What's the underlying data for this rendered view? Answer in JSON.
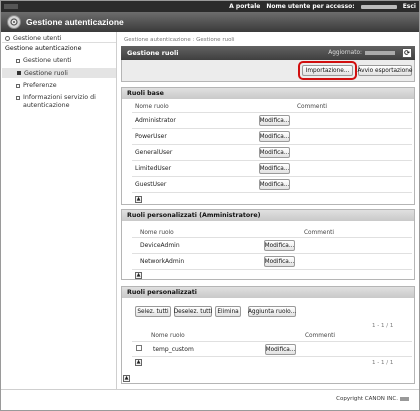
{
  "topbar": {
    "portal_link": "A portale",
    "user_label": "Nome utente per accesso:",
    "logout": "Esci"
  },
  "app": {
    "title": "Gestione autenticazione"
  },
  "sidebar": {
    "top": "Gestione utenti",
    "section": "Gestione autenticazione",
    "items": [
      {
        "label": "Gestione utenti"
      },
      {
        "label": "Gestione ruoli"
      },
      {
        "label": "Preferenze"
      },
      {
        "label": "Informazioni servizio di"
      },
      {
        "label": "autenticazione"
      }
    ]
  },
  "main": {
    "breadcrumb": "Gestione autenticazione : Gestione ruoli",
    "header_title": "Gestione ruoli",
    "updated_label": "Aggiornato:",
    "import_button": "Importazione...",
    "export_button": "Avvio esportazione"
  },
  "basic_roles": {
    "title": "Ruoli base",
    "col_name": "Nome ruolo",
    "col_comments": "Commenti",
    "edit_label": "Modifica...",
    "rows": [
      "Administrator",
      "PowerUser",
      "GeneralUser",
      "LimitedUser",
      "GuestUser"
    ]
  },
  "custom_admin_roles": {
    "title": "Ruoli personalizzati (Amministratore)",
    "col_name": "Nome ruolo",
    "col_comments": "Commenti",
    "edit_label": "Modifica...",
    "rows": [
      "DeviceAdmin",
      "NetworkAdmin"
    ]
  },
  "custom_roles": {
    "title": "Ruoli personalizzati",
    "select_all": "Selez. tutti",
    "deselect_all": "Deselez. tutti",
    "delete": "Elimina",
    "add_role": "Aggiunta ruolo...",
    "pager": "1 - 1 / 1",
    "col_name": "Nome ruolo",
    "col_comments": "Commenti",
    "edit_label": "Modifica...",
    "rows": [
      "temp_custom"
    ]
  },
  "footer": {
    "copyright": "Copyright CANON INC."
  },
  "colors": {
    "accent_highlight": "#d10f0f",
    "header_dark": "#4a4a4a"
  }
}
